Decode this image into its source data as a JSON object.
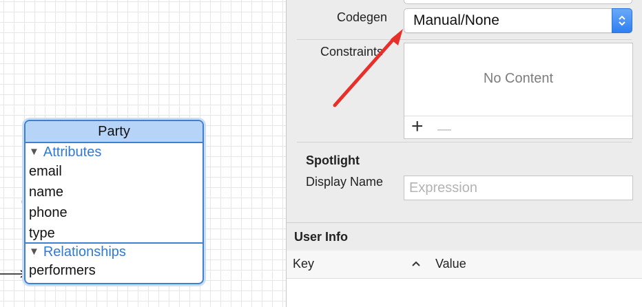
{
  "entity": {
    "name": "Party",
    "attributes_header": "Attributes",
    "attributes": [
      "email",
      "name",
      "phone",
      "type"
    ],
    "relationships_header": "Relationships",
    "relationships": [
      "performers"
    ]
  },
  "inspector": {
    "codegen_label": "Codegen",
    "codegen_value": "Manual/None",
    "constraints_label": "Constraints",
    "constraints_empty": "No Content",
    "add_symbol": "+",
    "remove_symbol": "—",
    "spotlight_header": "Spotlight",
    "display_name_label": "Display Name",
    "display_name_placeholder": "Expression",
    "user_info_header": "User Info",
    "key_column": "Key",
    "sort_symbol": "^",
    "value_column": "Value"
  },
  "colors": {
    "accent": "#2f7ff2",
    "entity_border": "#3f7fd0",
    "entity_header": "#b6d4f7",
    "annotation_arrow": "#e8302b"
  },
  "icons": {
    "popup": "up-down-stepper-icon",
    "relationship": "relationship-arrow-icon",
    "callout": "red-arrow-annotation-icon"
  }
}
